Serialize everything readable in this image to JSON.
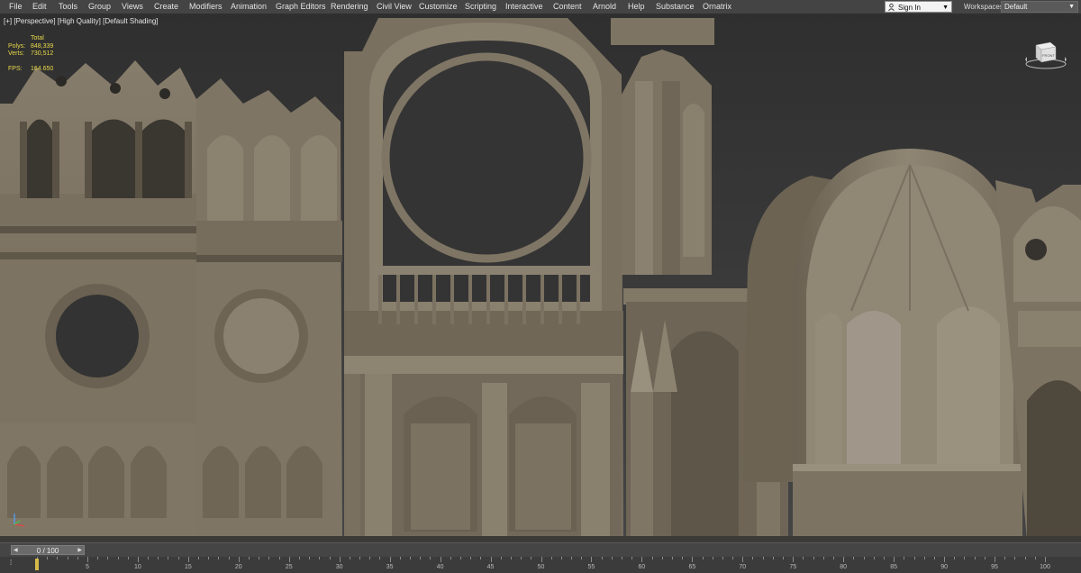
{
  "menubar": {
    "items": [
      "File",
      "Edit",
      "Tools",
      "Group",
      "Views",
      "Create",
      "Modifiers",
      "Animation",
      "Graph Editors",
      "Rendering",
      "Civil View",
      "Customize",
      "Scripting",
      "Interactive",
      "Content",
      "Arnold",
      "Help",
      "Substance",
      "Ornatrix"
    ],
    "sign_in": "Sign In",
    "workspaces_label": "Workspaces:",
    "workspace_value": "Default"
  },
  "viewport": {
    "labels": [
      "[+]",
      "[Perspective]",
      "[High Quality]",
      "[Default Shading]"
    ],
    "stats": {
      "header": "Total",
      "polys_label": "Polys:",
      "polys_value": "848,339",
      "verts_label": "Verts:",
      "verts_value": "730,512",
      "fps_label": "FPS:",
      "fps_value": "164.650"
    },
    "viewcube_face": "FRONT"
  },
  "timeline": {
    "slider_text": "0 / 100",
    "ticks": [
      "0",
      "5",
      "10",
      "15",
      "20",
      "25",
      "30",
      "35",
      "40",
      "45",
      "50",
      "55",
      "60",
      "65",
      "70",
      "75",
      "80",
      "85",
      "90",
      "95",
      "100"
    ],
    "current_frame": 0
  },
  "colors": {
    "stats_text": "#e8d84a",
    "stone": "#7c7262",
    "stone_light": "#948a79",
    "stone_dark": "#4c4438",
    "background": "#2f2f2f"
  }
}
